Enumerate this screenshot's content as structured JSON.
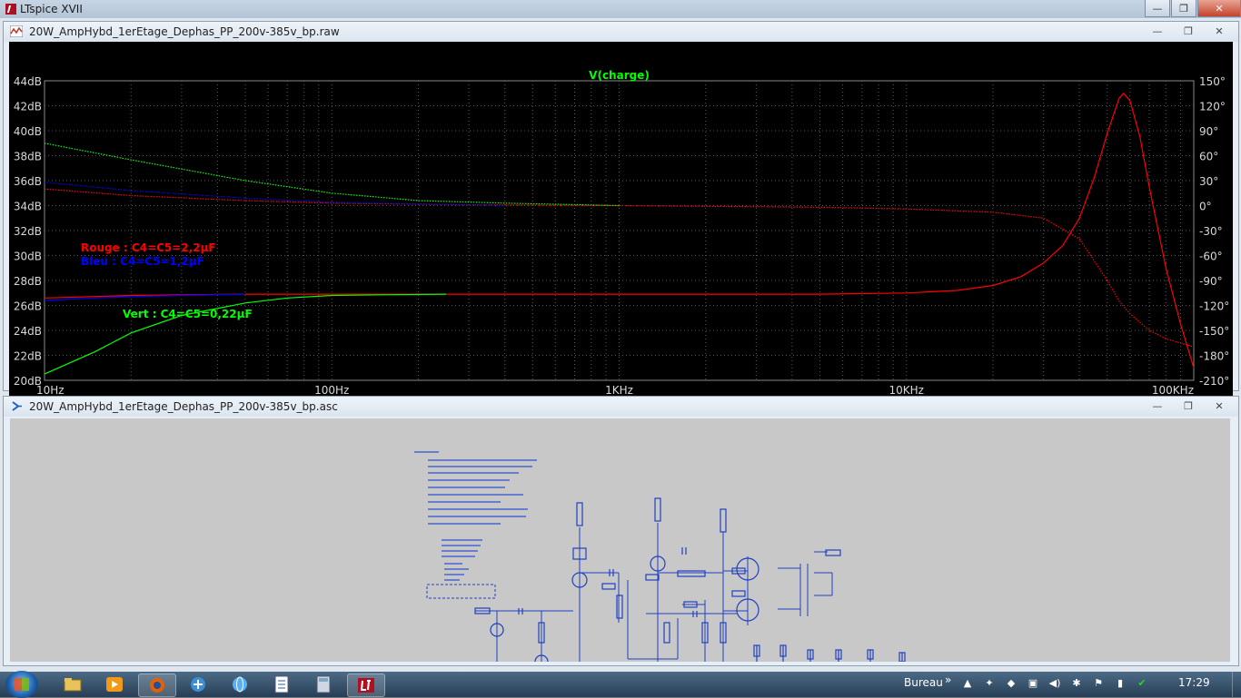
{
  "app": {
    "title": "LTspice XVII"
  },
  "window_controls": {
    "minimize": "—",
    "maximize": "❐",
    "close": "✕"
  },
  "waveform_window": {
    "title": "20W_AmpHybd_1erEtage_Dephas_PP_200v-385v_bp.raw",
    "trace_label": "V(charge)",
    "annotations": [
      {
        "text": "Rouge : C4=C5=2,2µF",
        "color": "#ff0000"
      },
      {
        "text": "Bleu : C4=C5=1,2µF",
        "color": "#0000ff"
      },
      {
        "text": "Vert : C4=C5=0,22µF",
        "color": "#00ff00"
      }
    ]
  },
  "schematic_window": {
    "title": "20W_AmpHybd_1erEtage_Dephas_PP_200v-385v_bp.asc"
  },
  "chart_data": {
    "type": "line",
    "title": "V(charge)",
    "x_scale": "log",
    "xlim": [
      10,
      100000
    ],
    "x_ticks": [
      "10Hz",
      "100Hz",
      "1KHz",
      "10KHz",
      "100KHz"
    ],
    "y_left_ticks": [
      "44dB",
      "42dB",
      "40dB",
      "38dB",
      "36dB",
      "34dB",
      "32dB",
      "30dB",
      "28dB",
      "26dB",
      "24dB",
      "22dB",
      "20dB"
    ],
    "y_left_lim": [
      20,
      44
    ],
    "y_right_ticks": [
      "150°",
      "120°",
      "90°",
      "60°",
      "30°",
      "0°",
      "-30°",
      "-60°",
      "-90°",
      "-120°",
      "-150°",
      "-180°",
      "-210°"
    ],
    "y_right_lim": [
      -210,
      150
    ],
    "grid": true,
    "series": [
      {
        "name": "Rouge : C4=C5=2,2µF",
        "color": "#ff0000",
        "kind": "magnitude",
        "x": [
          10,
          20,
          50,
          100,
          200,
          1000,
          5000,
          10000,
          15000,
          20000,
          25000,
          30000,
          35000,
          40000,
          45000,
          50000,
          55000,
          57000,
          60000,
          65000,
          70000,
          80000,
          90000,
          100000
        ],
        "y": [
          26.6,
          26.8,
          26.9,
          26.9,
          26.9,
          26.9,
          26.9,
          27.0,
          27.2,
          27.6,
          28.3,
          29.4,
          30.8,
          33.0,
          36.2,
          39.8,
          42.6,
          43.0,
          42.4,
          39.5,
          35.5,
          29.0,
          24.5,
          21.0
        ]
      },
      {
        "name": "Bleu : C4=C5=1,2µF",
        "color": "#0000ff",
        "kind": "magnitude",
        "x": [
          10,
          15,
          20,
          30,
          50
        ],
        "y": [
          26.4,
          26.6,
          26.7,
          26.8,
          26.9
        ]
      },
      {
        "name": "Vert : C4=C5=0,22µF",
        "color": "#00ff00",
        "kind": "magnitude",
        "x": [
          10,
          15,
          20,
          30,
          50,
          70,
          100,
          150,
          250
        ],
        "y": [
          20.5,
          22.3,
          23.8,
          25.2,
          26.2,
          26.6,
          26.8,
          26.85,
          26.9
        ]
      },
      {
        "name": "Rouge : C4=C5=2,2µF",
        "color": "#ff0000",
        "kind": "phase",
        "x": [
          10,
          20,
          50,
          100,
          300,
          1000,
          5000,
          10000,
          20000,
          30000,
          40000,
          50000,
          55000,
          60000,
          70000,
          80000,
          100000
        ],
        "y": [
          20,
          12,
          6,
          3,
          1,
          0,
          -2,
          -4,
          -8,
          -15,
          -40,
          -90,
          -115,
          -130,
          -150,
          -160,
          -170
        ]
      },
      {
        "name": "Bleu : C4=C5=1,2µF",
        "color": "#0000ff",
        "kind": "phase",
        "x": [
          10,
          20,
          50,
          100,
          200,
          400
        ],
        "y": [
          28,
          18,
          9,
          4,
          2,
          0
        ]
      },
      {
        "name": "Vert : C4=C5=0,22µF",
        "color": "#00ff00",
        "kind": "phase",
        "x": [
          10,
          20,
          50,
          100,
          200,
          400,
          1000
        ],
        "y": [
          75,
          55,
          30,
          15,
          6,
          3,
          0
        ]
      }
    ]
  },
  "taskbar": {
    "clock": "17:29",
    "toolbar_label": "Bureau",
    "chevron": "»",
    "apps": [
      {
        "name": "explorer-icon"
      },
      {
        "name": "media-player-icon"
      },
      {
        "name": "firefox-icon"
      },
      {
        "name": "network-icon"
      },
      {
        "name": "globe-icon"
      },
      {
        "name": "document-icon"
      },
      {
        "name": "calculator-icon"
      },
      {
        "name": "ltspice-icon"
      }
    ]
  }
}
